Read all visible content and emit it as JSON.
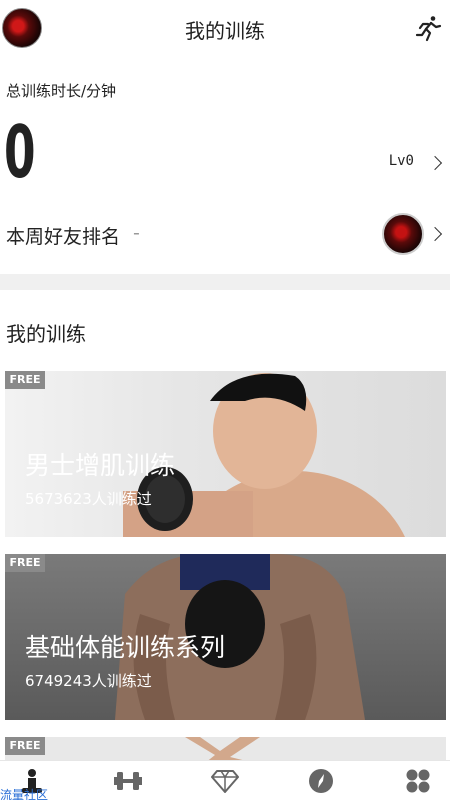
{
  "header": {
    "title": "我的训练"
  },
  "stats": {
    "total_label": "总训练时长/分钟",
    "total_value": "0",
    "level": "Lv0",
    "weekly_rank_label": "本周好友排名",
    "weekly_rank_value": "-"
  },
  "section": {
    "title": "我的训练"
  },
  "courses": [
    {
      "badge": "FREE",
      "name": "男士增肌训练",
      "count": "5673623人训练过"
    },
    {
      "badge": "FREE",
      "name": "基础体能训练系列",
      "count": "6749243人训练过"
    },
    {
      "badge": "FREE"
    }
  ],
  "tabbar": {
    "overlay_label": "流量社区",
    "tabs": [
      "training-icon",
      "dumbbell-icon",
      "diamond-icon",
      "compass-icon",
      "more-icon"
    ]
  },
  "colors": {
    "accent": "#2a6fd6",
    "divider": "#f0f0f0"
  }
}
